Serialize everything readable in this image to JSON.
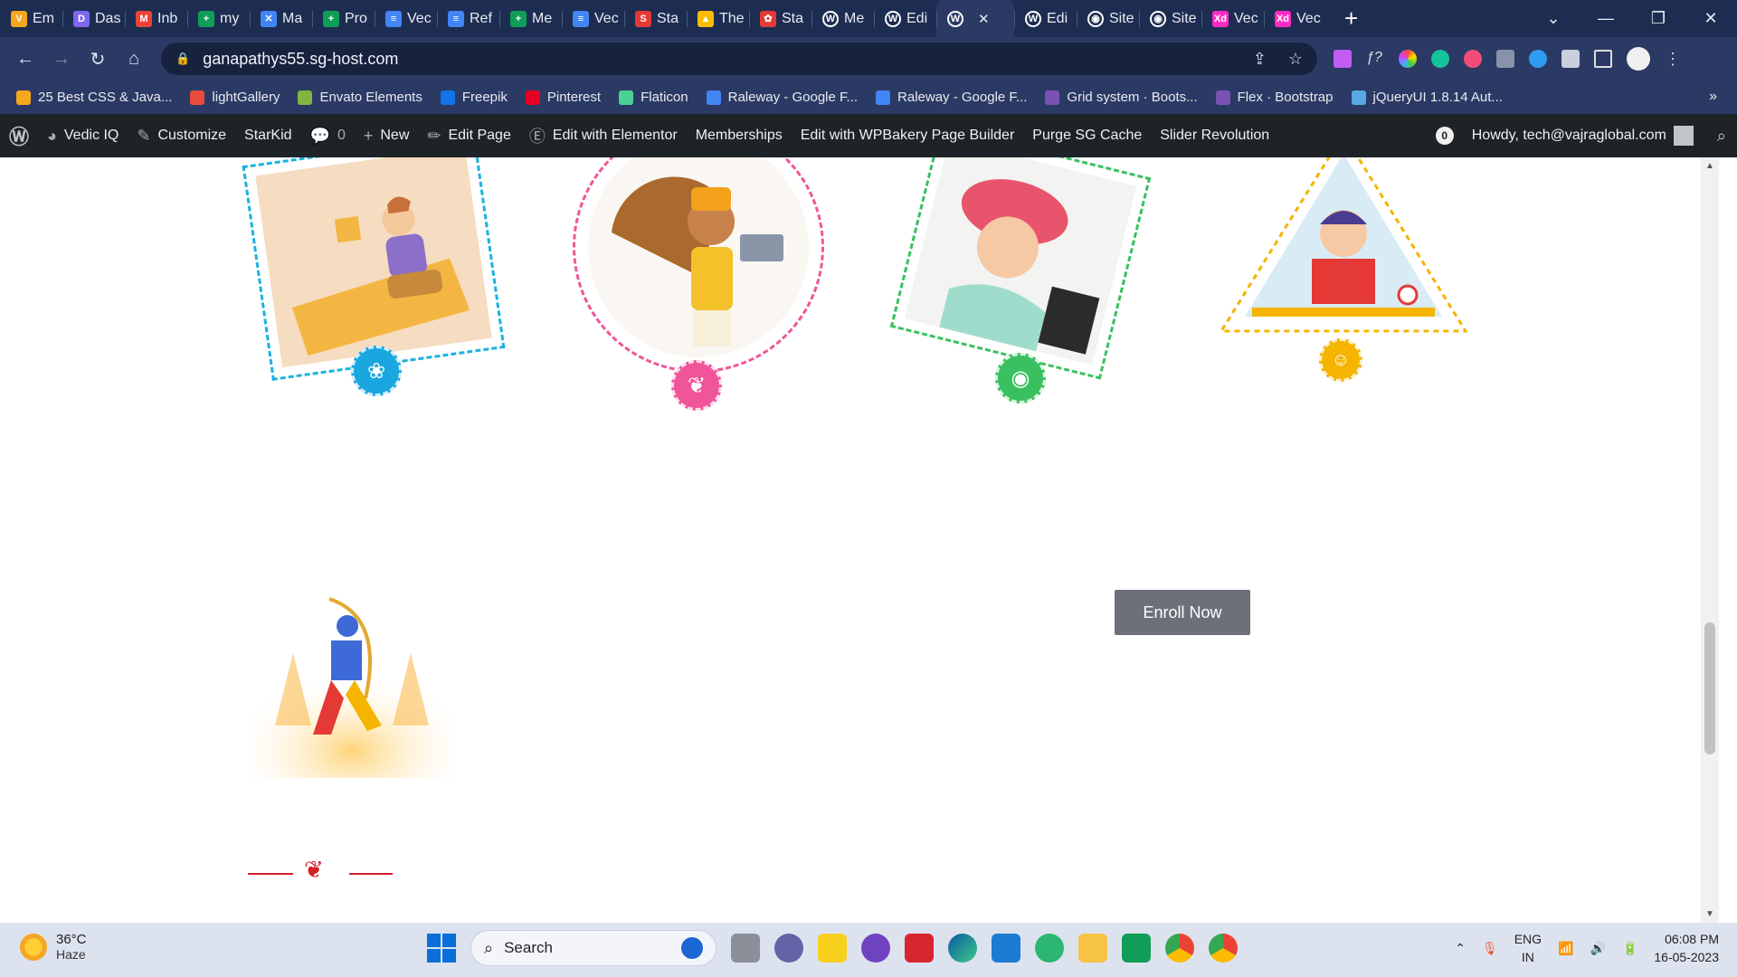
{
  "browser": {
    "tabs": [
      {
        "label": "Em",
        "color": "#f4a61d",
        "glyph": "V"
      },
      {
        "label": "Das",
        "color": "#7b68ee",
        "glyph": "D"
      },
      {
        "label": "Inb",
        "color": "#ea4335",
        "glyph": "M"
      },
      {
        "label": "my",
        "color": "#0f9d58",
        "glyph": "+"
      },
      {
        "label": "Ma",
        "color": "#4285f4",
        "glyph": "✕"
      },
      {
        "label": "Pro",
        "color": "#0f9d58",
        "glyph": "+"
      },
      {
        "label": "Vec",
        "color": "#4285f4",
        "glyph": "≡"
      },
      {
        "label": "Ref",
        "color": "#4285f4",
        "glyph": "≡"
      },
      {
        "label": "Me",
        "color": "#0f9d58",
        "glyph": "+"
      },
      {
        "label": "Vec",
        "color": "#4285f4",
        "glyph": "≡"
      },
      {
        "label": "Sta",
        "color": "#e53935",
        "glyph": "S"
      },
      {
        "label": "The",
        "color": "#fbbc04",
        "glyph": "▲"
      },
      {
        "label": "Sta",
        "color": "#e53935",
        "glyph": "✿"
      },
      {
        "label": "Me",
        "color": "#ffffff",
        "glyph": "W"
      },
      {
        "label": "Edi",
        "color": "#ffffff",
        "glyph": "W"
      },
      {
        "label": "",
        "color": "#ffffff",
        "glyph": "W",
        "active": true
      },
      {
        "label": "Edi",
        "color": "#ffffff",
        "glyph": "W"
      },
      {
        "label": "Site",
        "color": "#ffffff",
        "glyph": "◉"
      },
      {
        "label": "Site",
        "color": "#ffffff",
        "glyph": "◉"
      },
      {
        "label": "Vec",
        "color": "#ff2bc2",
        "glyph": "Xd"
      },
      {
        "label": "Vec",
        "color": "#ff2bc2",
        "glyph": "Xd"
      }
    ],
    "url": "ganapathys55.sg-host.com",
    "bookmarks": [
      {
        "label": "25 Best CSS & Java...",
        "color": "#f4a61d"
      },
      {
        "label": "lightGallery",
        "color": "#e84c3d"
      },
      {
        "label": "Envato Elements",
        "color": "#82b541"
      },
      {
        "label": "Freepik",
        "color": "#1273eb"
      },
      {
        "label": "Pinterest",
        "color": "#e60023"
      },
      {
        "label": "Flaticon",
        "color": "#4ad295"
      },
      {
        "label": "Raleway - Google F...",
        "color": "#4285f4"
      },
      {
        "label": "Raleway - Google F...",
        "color": "#4285f4"
      },
      {
        "label": "Grid system · Boots...",
        "color": "#7952b3"
      },
      {
        "label": "Flex · Bootstrap",
        "color": "#7952b3"
      },
      {
        "label": "jQueryUI 1.8.14 Aut...",
        "color": "#5aa9e6"
      }
    ]
  },
  "adminbar": {
    "site": "Vedic IQ",
    "customize": "Customize",
    "theme": "StarKid",
    "comments": "0",
    "new": "New",
    "edit_page": "Edit Page",
    "elementor": "Edit with Elementor",
    "memberships": "Memberships",
    "wpbakery": "Edit with WPBakery Page Builder",
    "purge": "Purge SG Cache",
    "slider": "Slider Revolution",
    "notif": "0",
    "howdy": "Howdy, tech@vajraglobal.com"
  },
  "page": {
    "cards": [
      {
        "shape": "square",
        "badge_color": "#1aa7e0",
        "border_color": "#1ab2e0",
        "badge_icon": "flower-icon",
        "glyph": "❀"
      },
      {
        "shape": "circle",
        "badge_color": "#f0559a",
        "border_color": "#f0559a",
        "badge_icon": "butterfly-icon",
        "glyph": "❦"
      },
      {
        "shape": "square",
        "badge_color": "#3ac060",
        "border_color": "#3ac060",
        "badge_icon": "apple-icon",
        "glyph": "◉"
      },
      {
        "shape": "triangle",
        "badge_color": "#f4b400",
        "border_color": "#f4b400",
        "badge_icon": "teddy-bear-icon",
        "glyph": "☺"
      }
    ],
    "enroll_button": "Enroll Now"
  },
  "taskbar": {
    "temperature": "36°C",
    "weather": "Haze",
    "search": "Search",
    "lang1": "ENG",
    "lang2": "IN",
    "time": "06:08 PM",
    "date": "16-05-2023"
  }
}
